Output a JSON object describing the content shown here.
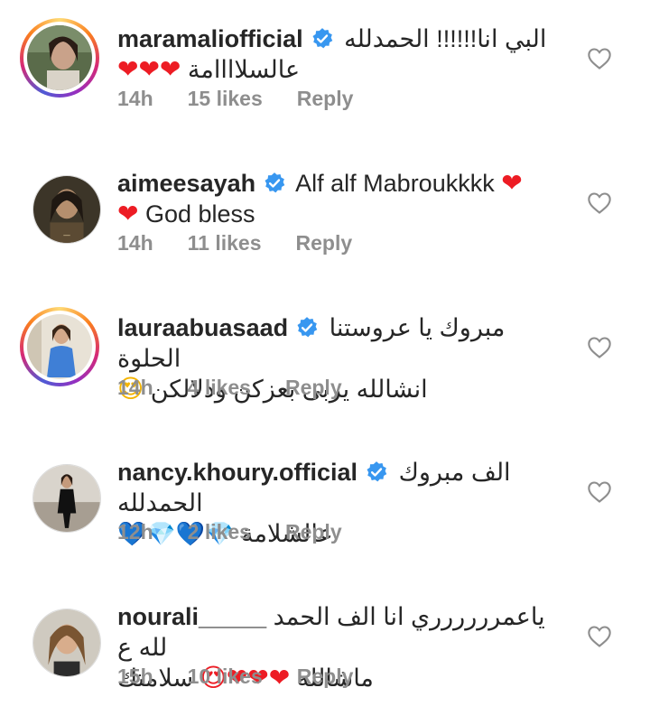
{
  "comments": [
    {
      "username": "maramaliofficial",
      "text_line1": "البي انا!!!!!! الحمدلله",
      "text_line2": "عالسلاااامة",
      "line2_emojis": "❤❤❤",
      "time": "14h",
      "likes": "15 likes",
      "reply": "Reply",
      "story_ring": true
    },
    {
      "username": "aimeesayah",
      "text_line1": "Alf alf Mabroukkkk",
      "line1_emojis": "❤",
      "text_line2": "God bless",
      "line2_emojis": "❤",
      "time": "14h",
      "likes": "11 likes",
      "reply": "Reply",
      "story_ring": false
    },
    {
      "username": "lauraabuasaad",
      "text_line1": "مبروك يا عروستنا الحلوة",
      "text_line2": "انشالله يربى بعزكن ودلالكن",
      "line2_emojis": "😍",
      "time": "14h",
      "likes": "4 likes",
      "reply": "Reply",
      "story_ring": true
    },
    {
      "username": "nancy.khoury.official",
      "text_line1": "الف مبروك الحمدلله",
      "text_line2": "عالشلامة",
      "line2_emojis": "💙💎💙💎",
      "time": "12h",
      "likes": "2 likes",
      "reply": "Reply",
      "story_ring": false
    },
    {
      "username": "nourali_____",
      "text_line1": "ياعمرررررري انا الف الحمد لله ع",
      "text_line2": "ماشالله",
      "line2_emojis": "❤❤❤😍",
      "text_line2b": "سلامتك",
      "time": "15h",
      "likes": "10 likes",
      "reply": "Reply",
      "story_ring": false
    }
  ],
  "colors": {
    "verified": "#3897f0",
    "meta": "#8e8e8e",
    "text": "#262626",
    "heart": "#ed1c24"
  }
}
